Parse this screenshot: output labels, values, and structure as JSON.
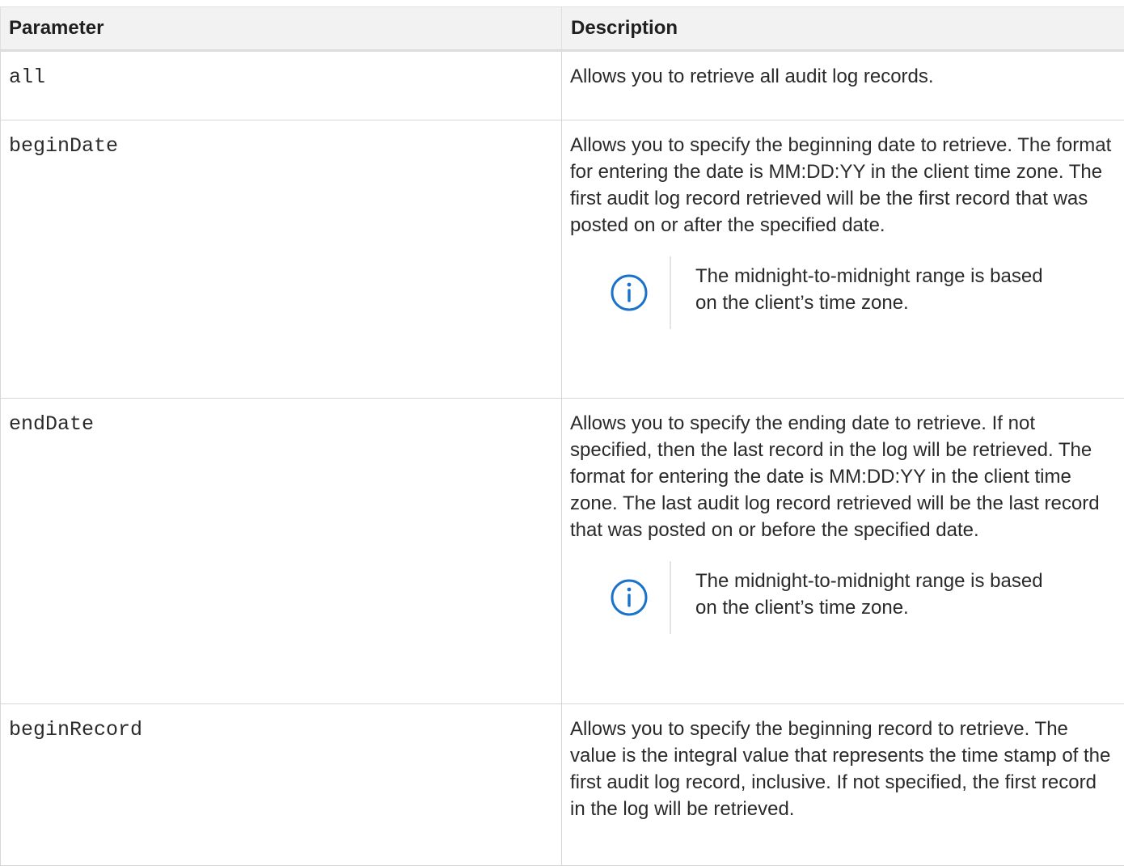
{
  "table": {
    "headers": {
      "parameter": "Parameter",
      "description": "Description"
    },
    "rows": [
      {
        "parameter": "all",
        "description": "Allows you to retrieve all audit log records.",
        "note": null
      },
      {
        "parameter": "beginDate",
        "description": "Allows you to specify the beginning date to retrieve. The format for entering the date is MM:DD:YY in the client time zone. The first audit log record retrieved will be the first record that was posted on or after the specified date.",
        "note": "The midnight-to-midnight range is based on the client’s time zone."
      },
      {
        "parameter": "endDate",
        "description": "Allows you to specify the ending date to retrieve. If not specified, then the last record in the log will be retrieved. The format for entering the date is MM:DD:YY in the client time zone. The last audit log record retrieved will be the last record that was posted on or before the specified date.",
        "note": "The midnight-to-midnight range is based on the client’s time zone."
      },
      {
        "parameter": "beginRecord",
        "description": "Allows you to specify the beginning record to retrieve. The value is the integral value that represents the time stamp of the first audit log record, inclusive. If not specified, the first record in the log will be retrieved.",
        "note": null
      }
    ]
  },
  "colors": {
    "info_icon": "#1a73c9",
    "header_bg": "#f2f2f2",
    "border": "#d6d6d6"
  },
  "icons": {
    "note": "info-icon"
  }
}
